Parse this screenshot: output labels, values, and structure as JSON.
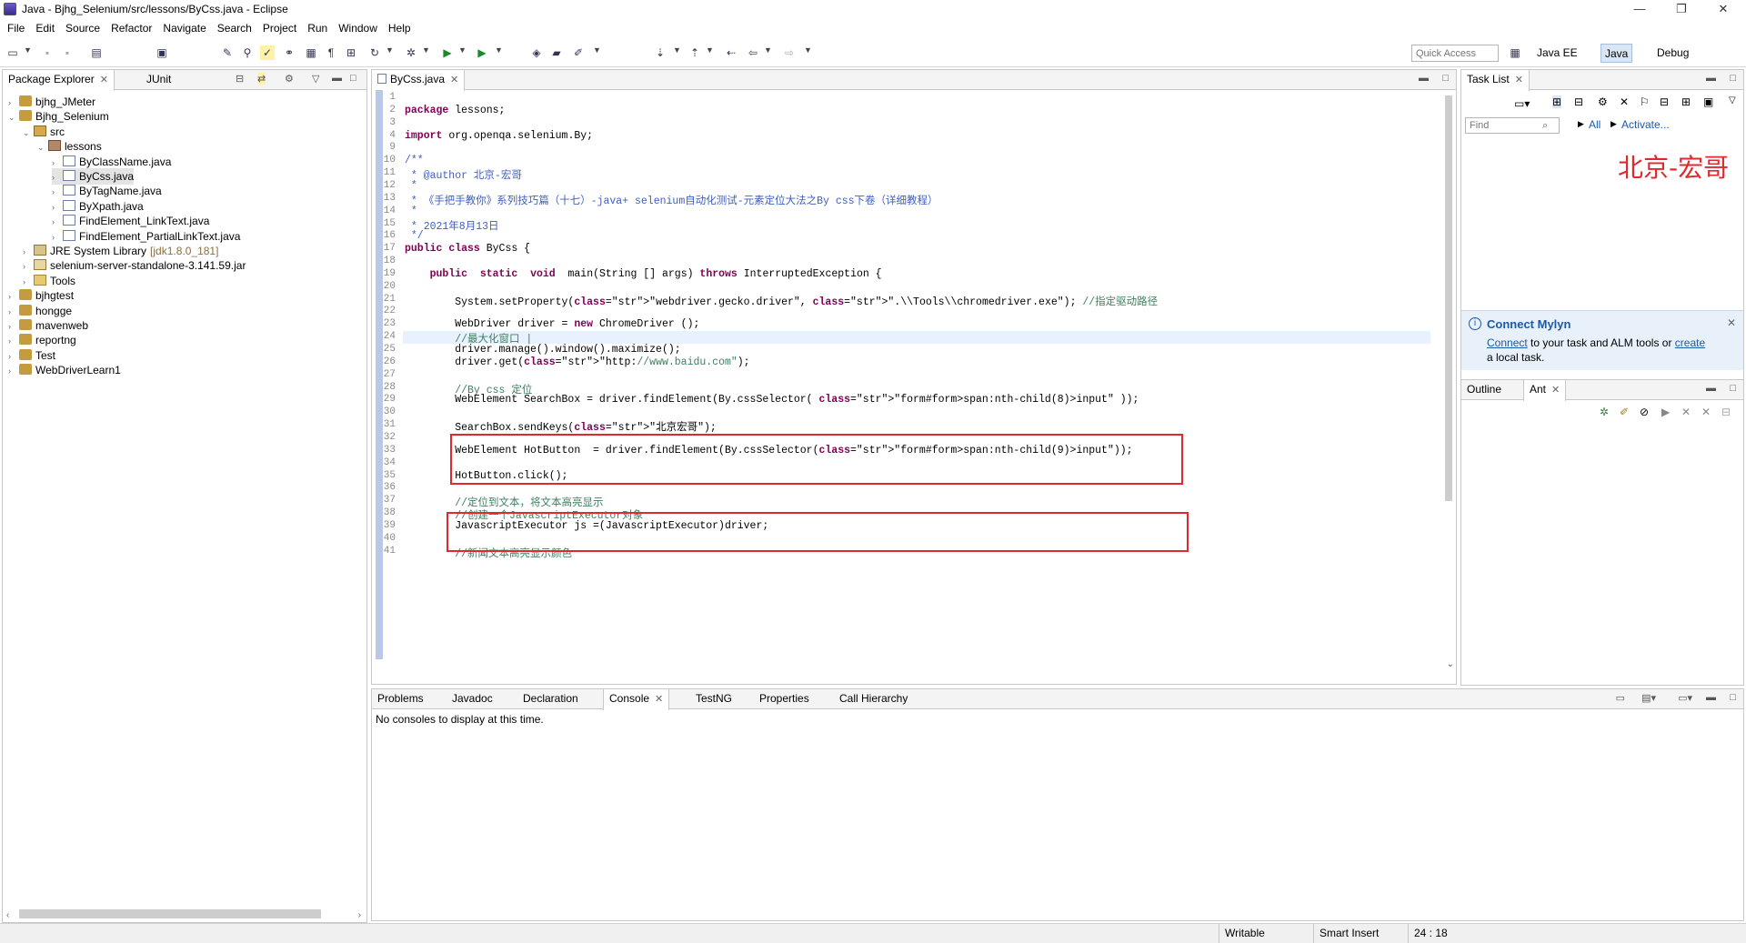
{
  "window": {
    "title": "Java - Bjhg_Selenium/src/lessons/ByCss.java - Eclipse",
    "minimize": "—",
    "maximize": "❐",
    "close": "✕"
  },
  "menu": [
    "File",
    "Edit",
    "Source",
    "Refactor",
    "Navigate",
    "Search",
    "Project",
    "Run",
    "Window",
    "Help"
  ],
  "toolbar": {
    "quick_access_placeholder": "Quick Access",
    "perspectives": [
      "Java EE",
      "Java",
      "Debug"
    ]
  },
  "left_panel": {
    "tabs": [
      "Package Explorer",
      "JUnit"
    ],
    "tree": [
      {
        "label": "bjhg_JMeter",
        "level": 0,
        "icon": "project",
        "expanded": false
      },
      {
        "label": "Bjhg_Selenium",
        "level": 0,
        "icon": "project",
        "expanded": true
      },
      {
        "label": "src",
        "level": 1,
        "icon": "source-folder",
        "expanded": true
      },
      {
        "label": "lessons",
        "level": 2,
        "icon": "package",
        "expanded": true
      },
      {
        "label": "ByClassName.java",
        "level": 3,
        "icon": "java-file"
      },
      {
        "label": "ByCss.java",
        "level": 3,
        "icon": "java-file",
        "selected": true
      },
      {
        "label": "ByTagName.java",
        "level": 3,
        "icon": "java-file"
      },
      {
        "label": "ByXpath.java",
        "level": 3,
        "icon": "java-file"
      },
      {
        "label": "FindElement_LinkText.java",
        "level": 3,
        "icon": "java-file"
      },
      {
        "label": "FindElement_PartialLinkText.java",
        "level": 3,
        "icon": "java-file"
      },
      {
        "label": "JRE System Library",
        "suffix": "[jdk1.8.0_181]",
        "level": 1,
        "icon": "library"
      },
      {
        "label": "selenium-server-standalone-3.141.59.jar",
        "level": 1,
        "icon": "jar"
      },
      {
        "label": "Tools",
        "level": 1,
        "icon": "folder"
      },
      {
        "label": "bjhgtest",
        "level": 0,
        "icon": "project"
      },
      {
        "label": "honggе",
        "level": 0,
        "icon": "project"
      },
      {
        "label": "mavenweb",
        "level": 0,
        "icon": "project"
      },
      {
        "label": "reportng",
        "level": 0,
        "icon": "project"
      },
      {
        "label": "Test",
        "level": 0,
        "icon": "project"
      },
      {
        "label": "WebDriverLearn1",
        "level": 0,
        "icon": "project"
      }
    ]
  },
  "editor": {
    "tab": "ByCss.java",
    "lines": [
      {
        "n": "1",
        "t": ""
      },
      {
        "n": "2",
        "t": "package lessons;"
      },
      {
        "n": "3",
        "t": ""
      },
      {
        "n": "4",
        "t": "import org.openqa.selenium.By;"
      },
      {
        "n": "9",
        "t": ""
      },
      {
        "n": "10",
        "t": "/**"
      },
      {
        "n": "11",
        "t": " * @author 北京-宏哥"
      },
      {
        "n": "12",
        "t": " *"
      },
      {
        "n": "13",
        "t": " * 《手把手教你》系列技巧篇（十七）-java+ selenium自动化测试-元素定位大法之By css下卷（详细教程）"
      },
      {
        "n": "14",
        "t": " *"
      },
      {
        "n": "15",
        "t": " * 2021年8月13日"
      },
      {
        "n": "16",
        "t": " */"
      },
      {
        "n": "17",
        "t": "public class ByCss {"
      },
      {
        "n": "18",
        "t": ""
      },
      {
        "n": "19",
        "t": "    public  static  void  main(String [] args) throws InterruptedException {"
      },
      {
        "n": "20",
        "t": ""
      },
      {
        "n": "21",
        "t": "        System.setProperty(\"webdriver.gecko.driver\", \".\\\\Tools\\\\chromedriver.exe\"); //指定驱动路径"
      },
      {
        "n": "22",
        "t": ""
      },
      {
        "n": "23",
        "t": "        WebDriver driver = new ChromeDriver ();"
      },
      {
        "n": "24",
        "t": "        //最大化窗口 |"
      },
      {
        "n": "25",
        "t": "        driver.manage().window().maximize();"
      },
      {
        "n": "26",
        "t": "        driver.get(\"http://www.baidu.com\");"
      },
      {
        "n": "27",
        "t": ""
      },
      {
        "n": "28",
        "t": "        //By css 定位"
      },
      {
        "n": "29",
        "t": "        WebElement SearchBox = driver.findElement(By.cssSelector( \"form#form>span:nth-child(8)>input\" ));"
      },
      {
        "n": "30",
        "t": ""
      },
      {
        "n": "31",
        "t": "        SearchBox.sendKeys(\"北京宏哥\");"
      },
      {
        "n": "32",
        "t": ""
      },
      {
        "n": "33",
        "t": "        WebElement HotButton  = driver.findElement(By.cssSelector(\"form#form>span:nth-child(9)>input\"));"
      },
      {
        "n": "34",
        "t": ""
      },
      {
        "n": "35",
        "t": "        HotButton.click();"
      },
      {
        "n": "36",
        "t": ""
      },
      {
        "n": "37",
        "t": "        //定位到文本，将文本高亮显示"
      },
      {
        "n": "38",
        "t": "        //创建一个JavascriptExecutor对象"
      },
      {
        "n": "39",
        "t": "        JavascriptExecutor js =(JavascriptExecutor)driver;"
      },
      {
        "n": "40",
        "t": ""
      },
      {
        "n": "41",
        "t": "        //新闻文本高亮显示颜色"
      }
    ]
  },
  "right_panel": {
    "tab": "Task List",
    "find_placeholder": "Find",
    "all_label": "All",
    "activate_label": "Activate...",
    "watermark": "北京-宏哥",
    "mylyn": {
      "title": "Connect Mylyn",
      "connect_link": "Connect",
      "middle": " to your task and ALM tools or ",
      "create_link": "create",
      "tail": "a local task."
    },
    "outline_tabs": [
      "Outline",
      "Ant"
    ]
  },
  "bottom_panel": {
    "tabs": [
      "Problems",
      "Javadoc",
      "Declaration",
      "Console",
      "TestNG",
      "Properties",
      "Call Hierarchy"
    ],
    "active_tab": "Console",
    "message": "No consoles to display at this time."
  },
  "status": {
    "writable": "Writable",
    "insert_mode": "Smart Insert",
    "position": "24 : 18"
  },
  "colors": {
    "keyword": "#7f0055",
    "string": "#2a00ff",
    "comment": "#3f7f5f",
    "javadoc": "#3f5fbf",
    "highlight_box": "#e0282e",
    "watermark": "#e0282e",
    "link": "#1a5aa8"
  }
}
